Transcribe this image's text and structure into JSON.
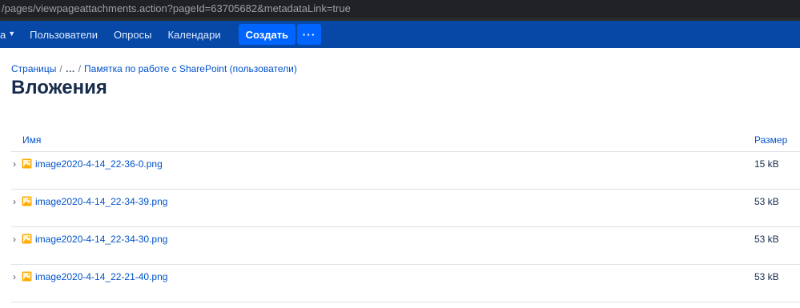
{
  "browser": {
    "url": "/pages/viewpageattachments.action?pageId=63705682&metadataLink=true"
  },
  "nav": {
    "cut_item_label": "а",
    "items": [
      {
        "label": "Пользователи"
      },
      {
        "label": "Опросы"
      },
      {
        "label": "Календари"
      }
    ],
    "create_label": "Создать",
    "more_label": "···"
  },
  "breadcrumb": {
    "items": [
      "Страницы",
      "…",
      "Памятка по работе с SharePoint (пользователи)"
    ],
    "separator": "/"
  },
  "page": {
    "title": "Вложения"
  },
  "attachments": {
    "columns": {
      "name": "Имя",
      "size": "Размер"
    },
    "rows": [
      {
        "name": "image2020-4-14_22-36-0.png",
        "size": "15 kB",
        "icon": "image-file-icon"
      },
      {
        "name": "image2020-4-14_22-34-39.png",
        "size": "53 kB",
        "icon": "image-file-icon"
      },
      {
        "name": "image2020-4-14_22-34-30.png",
        "size": "53 kB",
        "icon": "image-file-icon"
      },
      {
        "name": "image2020-4-14_22-21-40.png",
        "size": "53 kB",
        "icon": "image-file-icon"
      }
    ]
  },
  "colors": {
    "nav_bg": "#0747a6",
    "button_bg": "#0065ff",
    "link": "#0052cc",
    "image_icon": "#ffab00"
  }
}
